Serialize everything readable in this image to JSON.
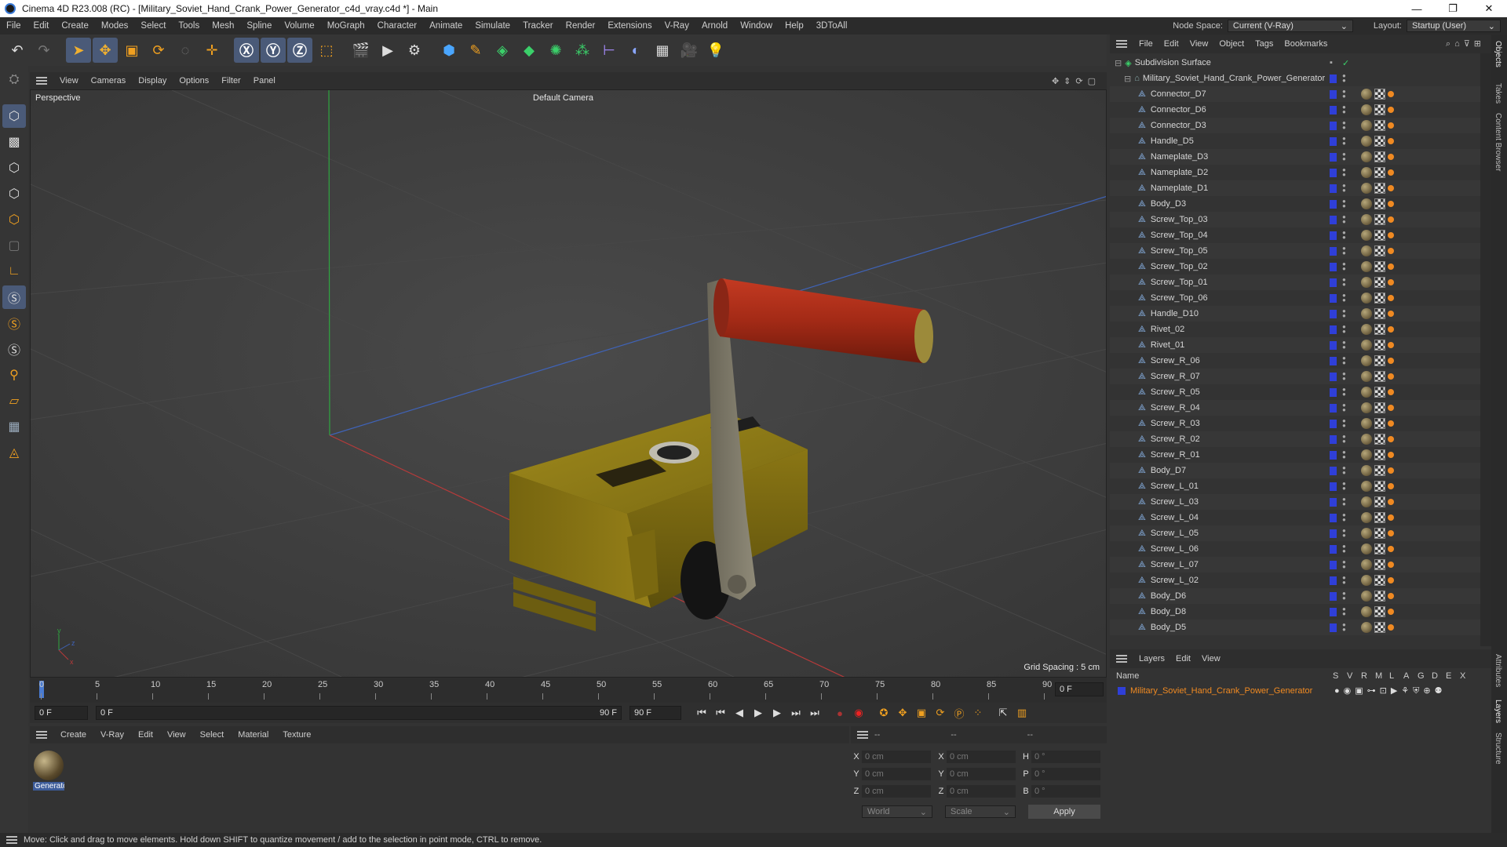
{
  "window": {
    "title": "Cinema 4D R23.008 (RC) - [Military_Soviet_Hand_Crank_Power_Generator_c4d_vray.c4d *] - Main",
    "controls": [
      "—",
      "❐",
      "✕"
    ]
  },
  "menubar": {
    "items": [
      "File",
      "Edit",
      "Create",
      "Modes",
      "Select",
      "Tools",
      "Mesh",
      "Spline",
      "Volume",
      "MoGraph",
      "Character",
      "Animate",
      "Simulate",
      "Tracker",
      "Render",
      "Extensions",
      "V-Ray",
      "Arnold",
      "Window",
      "Help",
      "3DToAll"
    ],
    "node_space_label": "Node Space:",
    "node_space_value": "Current (V-Ray)",
    "layout_label": "Layout:",
    "layout_value": "Startup (User)"
  },
  "viewport": {
    "menu": [
      "View",
      "Cameras",
      "Display",
      "Options",
      "Filter",
      "Panel"
    ],
    "label": "Perspective",
    "camera": "Default Camera",
    "grid_spacing": "Grid Spacing : 5 cm"
  },
  "timeline": {
    "ticks": [
      "0",
      "5",
      "10",
      "15",
      "20",
      "25",
      "30",
      "35",
      "40",
      "45",
      "50",
      "55",
      "60",
      "65",
      "70",
      "75",
      "80",
      "85",
      "90"
    ],
    "current_frame": "0 F",
    "start_field": "0 F",
    "range_start": "0 F",
    "range_end": "90 F",
    "end_field": "90 F"
  },
  "material_manager": {
    "menu": [
      "Create",
      "V-Ray",
      "Edit",
      "View",
      "Select",
      "Material",
      "Texture"
    ],
    "material_name": "Generator"
  },
  "coordinates": {
    "header": [
      "--",
      "--",
      "--"
    ],
    "rows": [
      {
        "a": "X",
        "av": "0 cm",
        "b": "X",
        "bv": "0 cm",
        "c": "H",
        "cv": "0 °"
      },
      {
        "a": "Y",
        "av": "0 cm",
        "b": "Y",
        "bv": "0 cm",
        "c": "P",
        "cv": "0 °"
      },
      {
        "a": "Z",
        "av": "0 cm",
        "b": "Z",
        "bv": "0 cm",
        "c": "B",
        "cv": "0 °"
      }
    ],
    "mode1": "World",
    "mode2": "Scale",
    "apply": "Apply"
  },
  "object_manager": {
    "menu": [
      "File",
      "Edit",
      "View",
      "Object",
      "Tags",
      "Bookmarks"
    ],
    "root": "Subdivision Surface",
    "group": "Military_Soviet_Hand_Crank_Power_Generator",
    "objects": [
      "Connector_D7",
      "Connector_D6",
      "Connector_D3",
      "Handle_D5",
      "Nameplate_D3",
      "Nameplate_D2",
      "Nameplate_D1",
      "Body_D3",
      "Screw_Top_03",
      "Screw_Top_04",
      "Screw_Top_05",
      "Screw_Top_02",
      "Screw_Top_01",
      "Screw_Top_06",
      "Handle_D10",
      "Rivet_02",
      "Rivet_01",
      "Screw_R_06",
      "Screw_R_07",
      "Screw_R_05",
      "Screw_R_04",
      "Screw_R_03",
      "Screw_R_02",
      "Screw_R_01",
      "Body_D7",
      "Screw_L_01",
      "Screw_L_03",
      "Screw_L_04",
      "Screw_L_05",
      "Screw_L_06",
      "Screw_L_07",
      "Screw_L_02",
      "Body_D6",
      "Body_D8",
      "Body_D5"
    ]
  },
  "layers": {
    "menu": [
      "Layers",
      "Edit",
      "View"
    ],
    "columns": [
      "Name",
      "S",
      "V",
      "R",
      "M",
      "L",
      "A",
      "G",
      "D",
      "E",
      "X"
    ],
    "layer_name": "Military_Soviet_Hand_Crank_Power_Generator"
  },
  "right_tabs": [
    "Objects",
    "Takes",
    "Content Browser",
    "Attributes",
    "Layers",
    "Structure"
  ],
  "status": "Move: Click and drag to move elements. Hold down SHIFT to quantize movement / add to the selection in point mode, CTRL to remove.",
  "colors": {
    "accent_blue": "#2f3fd8",
    "layer_orange": "#f08a22",
    "active_tool": "#4a5a78"
  }
}
